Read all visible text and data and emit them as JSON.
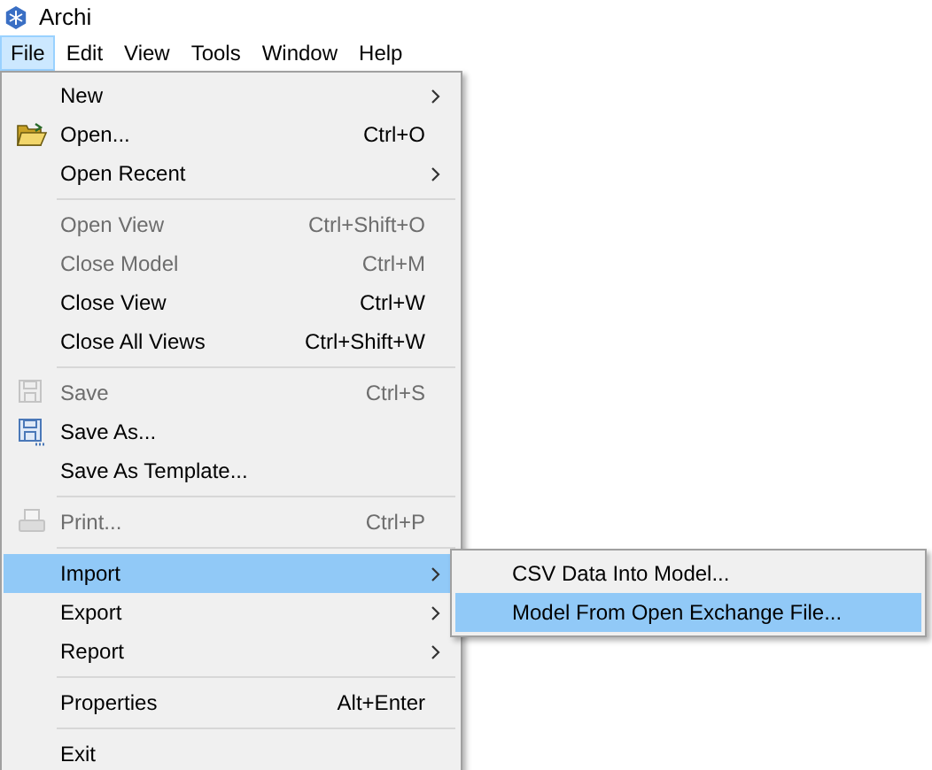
{
  "window": {
    "title": "Archi"
  },
  "menubar": [
    {
      "label": "File",
      "selected": true
    },
    {
      "label": "Edit",
      "selected": false
    },
    {
      "label": "View",
      "selected": false
    },
    {
      "label": "Tools",
      "selected": false
    },
    {
      "label": "Window",
      "selected": false
    },
    {
      "label": "Help",
      "selected": false
    }
  ],
  "file_menu": [
    {
      "kind": "item",
      "label": "New",
      "submenu": true,
      "disabled": false,
      "selected": false
    },
    {
      "kind": "item",
      "label": "Open...",
      "shortcut": "Ctrl+O",
      "disabled": false,
      "selected": false
    },
    {
      "kind": "item",
      "label": "Open Recent",
      "submenu": true,
      "disabled": false,
      "selected": false
    },
    {
      "kind": "separator"
    },
    {
      "kind": "item",
      "label": "Open View",
      "shortcut": "Ctrl+Shift+O",
      "disabled": true,
      "selected": false
    },
    {
      "kind": "item",
      "label": "Close Model",
      "shortcut": "Ctrl+M",
      "disabled": true,
      "selected": false
    },
    {
      "kind": "item",
      "label": "Close View",
      "shortcut": "Ctrl+W",
      "disabled": false,
      "selected": false
    },
    {
      "kind": "item",
      "label": "Close All Views",
      "shortcut": "Ctrl+Shift+W",
      "disabled": false,
      "selected": false
    },
    {
      "kind": "separator"
    },
    {
      "kind": "item",
      "label": "Save",
      "shortcut": "Ctrl+S",
      "disabled": true,
      "selected": false
    },
    {
      "kind": "item",
      "label": "Save As...",
      "disabled": false,
      "selected": false
    },
    {
      "kind": "item",
      "label": "Save As Template...",
      "disabled": false,
      "selected": false
    },
    {
      "kind": "separator"
    },
    {
      "kind": "item",
      "label": "Print...",
      "shortcut": "Ctrl+P",
      "disabled": true,
      "selected": false
    },
    {
      "kind": "separator"
    },
    {
      "kind": "item",
      "label": "Import",
      "submenu": true,
      "disabled": false,
      "selected": true
    },
    {
      "kind": "item",
      "label": "Export",
      "submenu": true,
      "disabled": false,
      "selected": false
    },
    {
      "kind": "item",
      "label": "Report",
      "submenu": true,
      "disabled": false,
      "selected": false
    },
    {
      "kind": "separator"
    },
    {
      "kind": "item",
      "label": "Properties",
      "shortcut": "Alt+Enter",
      "disabled": false,
      "selected": false
    },
    {
      "kind": "separator"
    },
    {
      "kind": "item",
      "label": "Exit",
      "disabled": false,
      "selected": false
    }
  ],
  "import_submenu": [
    {
      "label": "CSV Data Into Model...",
      "selected": false
    },
    {
      "label": "Model From Open Exchange File...",
      "selected": true
    }
  ]
}
